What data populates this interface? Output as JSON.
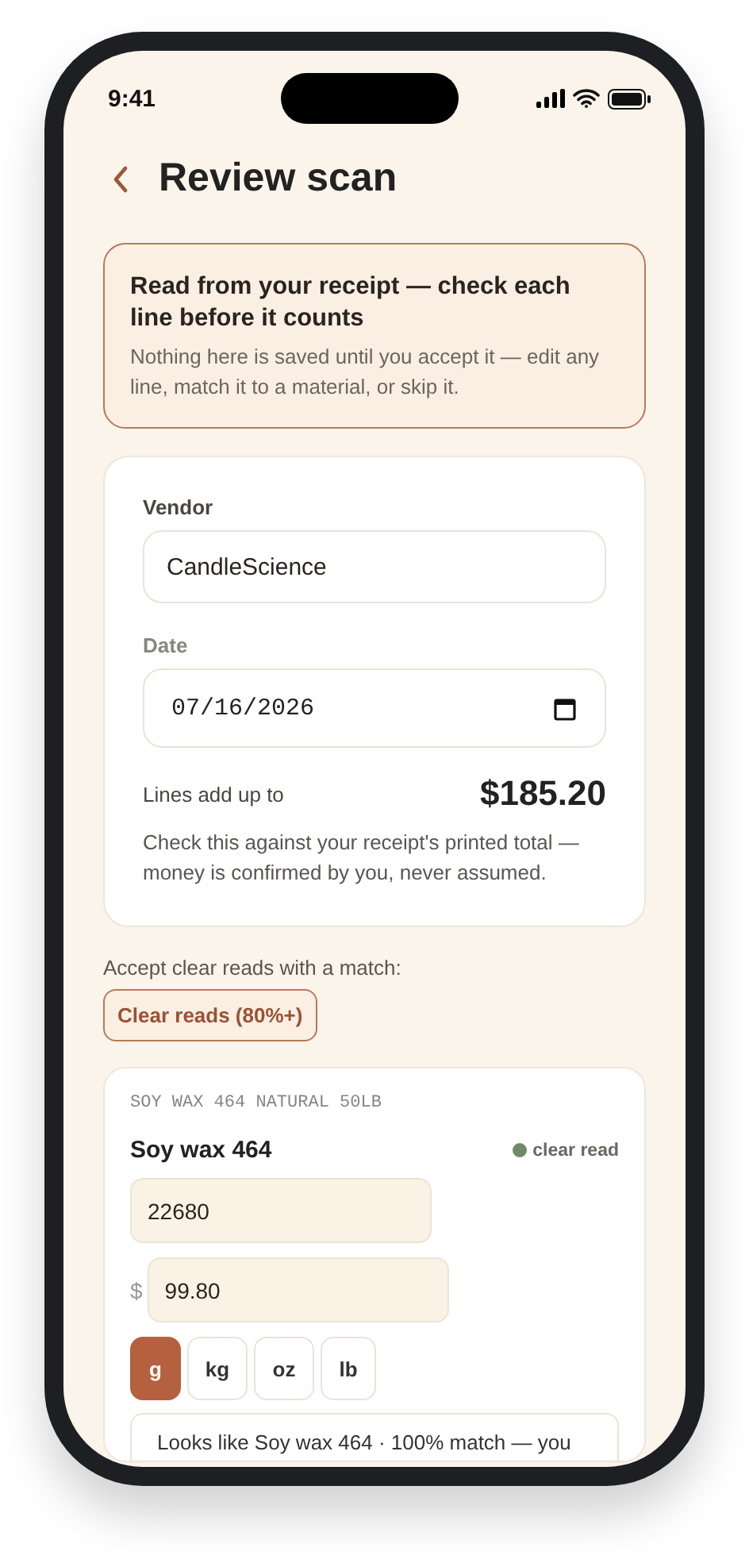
{
  "status_bar": {
    "time": "9:41"
  },
  "header": {
    "title": "Review scan"
  },
  "notice": {
    "title": "Read from your receipt — check each line before it counts",
    "body": "Nothing here is saved until you accept it — edit any line, match it to a material, or skip it."
  },
  "receipt": {
    "vendor": {
      "label": "Vendor",
      "value": "CandleScience"
    },
    "date": {
      "label": "Date",
      "value": "07/16/2026"
    },
    "total_label": "Lines add up to",
    "total": "$185.20",
    "note": "Check this against your receipt's printed total — money is confirmed by you, never assumed."
  },
  "bulk_accept": {
    "label": "Accept clear reads with a match:",
    "button": "Clear reads (80%+)"
  },
  "lines": [
    {
      "raw": "SOY WAX 464 NATURAL 50LB",
      "name": "Soy wax 464",
      "status": "clear read",
      "color": "#6f8a68",
      "quantity": "22680",
      "currency": "$",
      "price": "99.80",
      "units": [
        {
          "label": "g",
          "selected": true
        },
        {
          "label": "kg",
          "selected": false
        },
        {
          "label": "oz",
          "selected": false
        },
        {
          "label": "lb",
          "selected": false
        }
      ],
      "suggestion": "Looks like Soy wax 464 · 100% match — you"
    }
  ]
}
